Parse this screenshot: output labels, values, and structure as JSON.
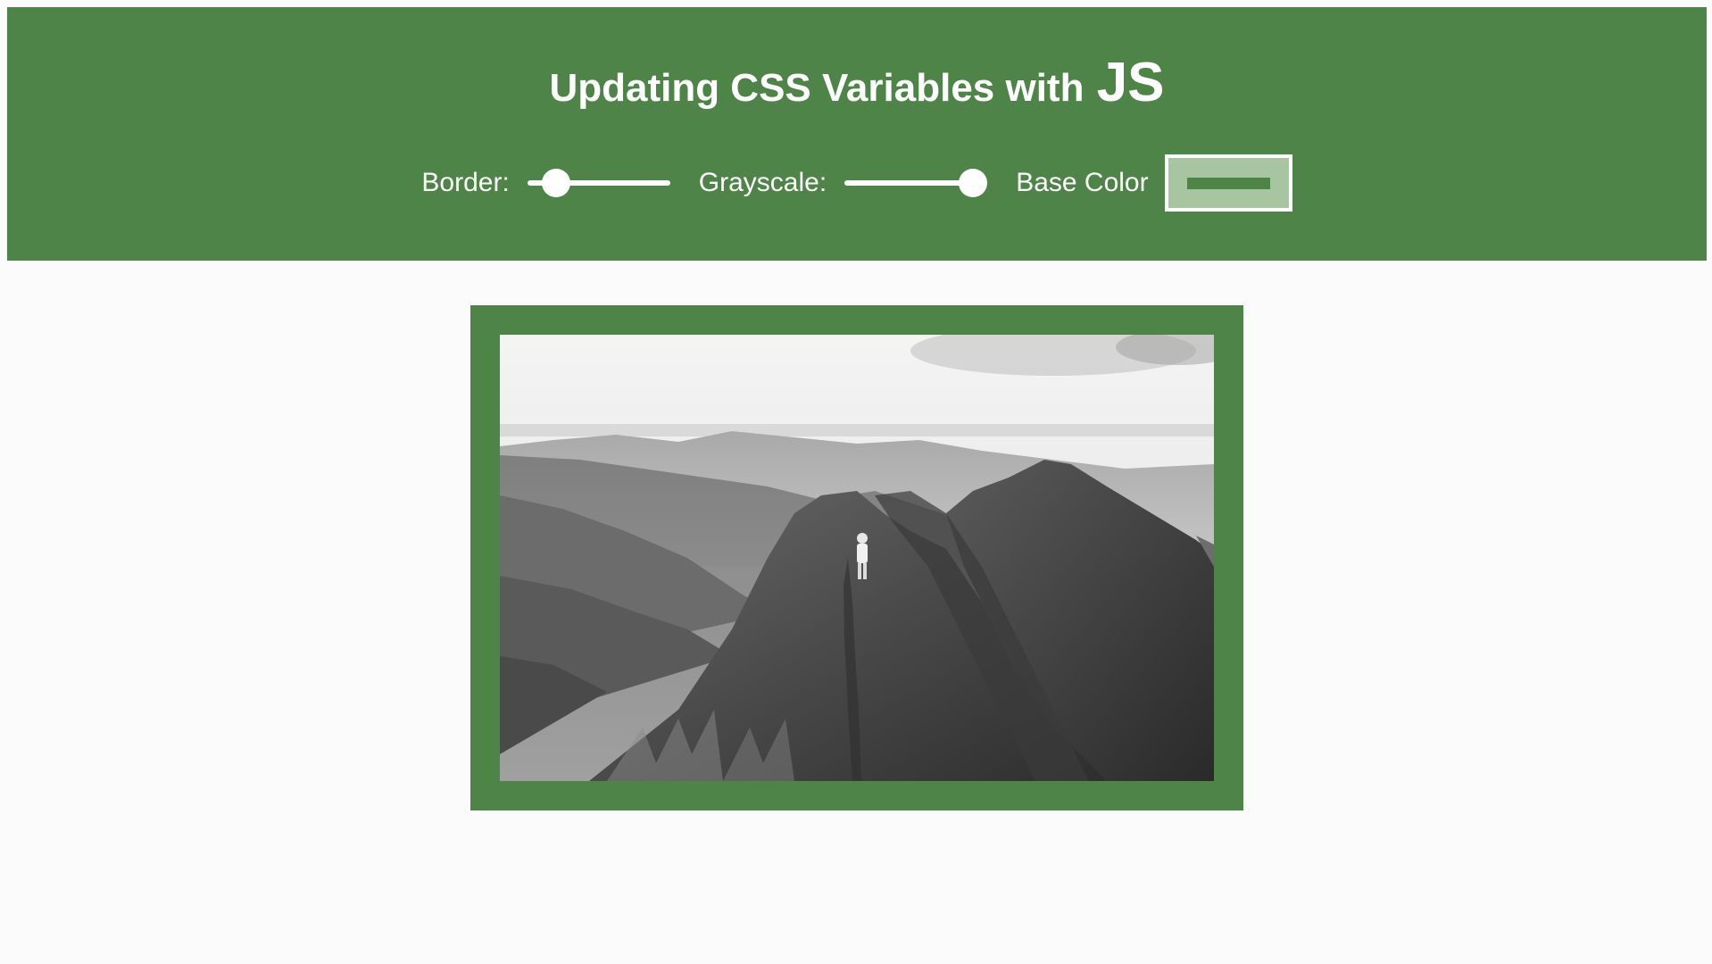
{
  "header": {
    "title_main": "Updating CSS Variables with",
    "title_js": "JS"
  },
  "controls": {
    "border": {
      "label": "Border:",
      "value_fraction": 0.2
    },
    "grayscale": {
      "label": "Grayscale:",
      "value_fraction": 0.9
    },
    "base_color": {
      "label": "Base Color",
      "value": "#4e8447"
    }
  },
  "colors": {
    "base": "#4e8447",
    "page_background": "#fbfbfb"
  }
}
